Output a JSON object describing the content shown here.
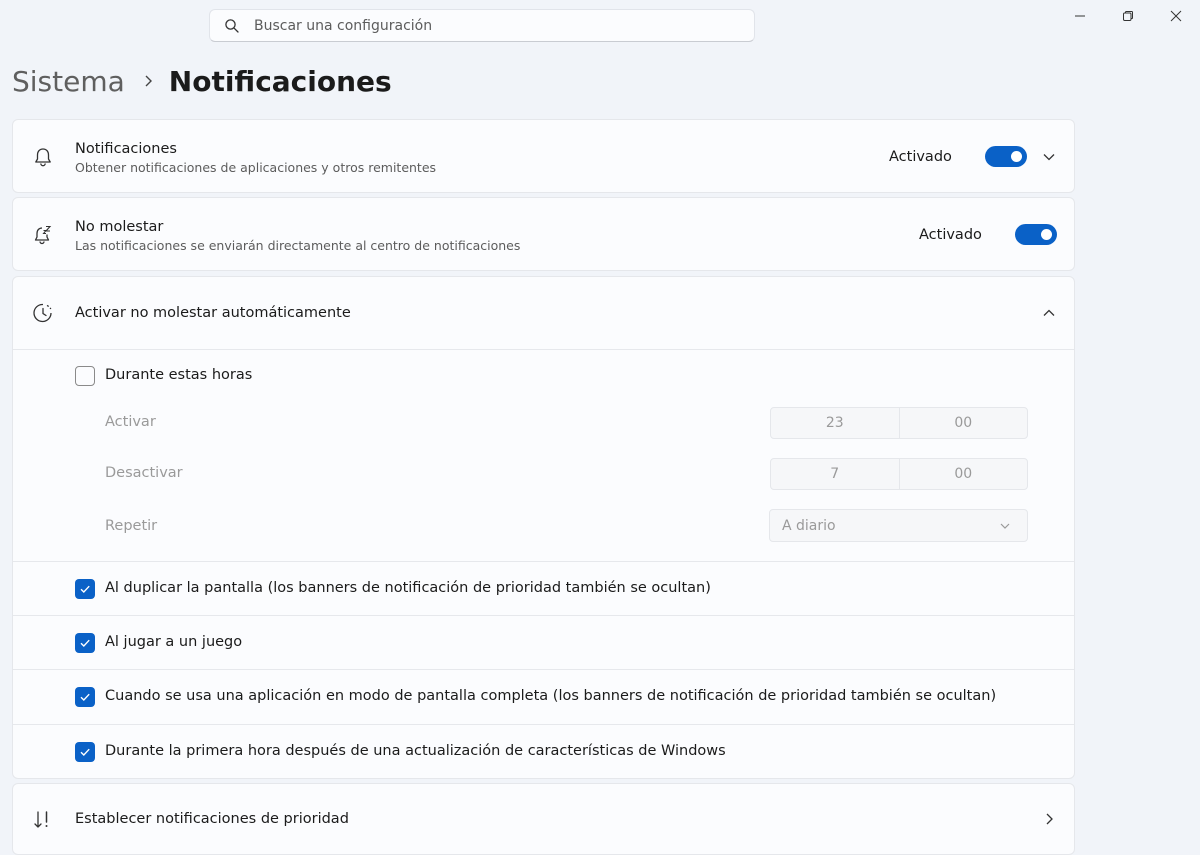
{
  "search": {
    "placeholder": "Buscar una configuración",
    "icon": "search-icon"
  },
  "breadcrumb": {
    "parent": "Sistema",
    "current": "Notificaciones"
  },
  "notifications": {
    "title": "Notificaciones",
    "description": "Obtener notificaciones de aplicaciones y otros remitentes",
    "toggle_label": "Activado",
    "enabled": true,
    "icon": "bell-icon"
  },
  "dnd": {
    "title": "No molestar",
    "description": "Las notificaciones se enviarán directamente al centro de notificaciones",
    "toggle_label": "Activado",
    "enabled": true,
    "icon": "bell-snooze-icon"
  },
  "auto_dnd": {
    "title": "Activar no molestar automáticamente",
    "icon": "clock-icon",
    "during_hours": {
      "label": "Durante estas horas",
      "checked": false,
      "on_label": "Activar",
      "on_hour": "23",
      "on_minute": "00",
      "off_label": "Desactivar",
      "off_hour": "7",
      "off_minute": "00",
      "repeat_label": "Repetir",
      "repeat_value": "A diario"
    },
    "options": [
      {
        "label": "Al duplicar la pantalla (los banners de notificación de prioridad también se ocultan)",
        "checked": true
      },
      {
        "label": "Al jugar a un juego",
        "checked": true
      },
      {
        "label": "Cuando se usa una aplicación en modo de pantalla completa (los banners de notificación de prioridad también se ocultan)",
        "checked": true
      },
      {
        "label": "Durante la primera hora después de una actualización de características de Windows",
        "checked": true
      }
    ]
  },
  "priority": {
    "title": "Establecer notificaciones de prioridad",
    "icon": "sort-priority-icon"
  },
  "colors": {
    "accent": "#0a61c7",
    "background": "#f1f4f9",
    "card": "#fbfcfe"
  }
}
